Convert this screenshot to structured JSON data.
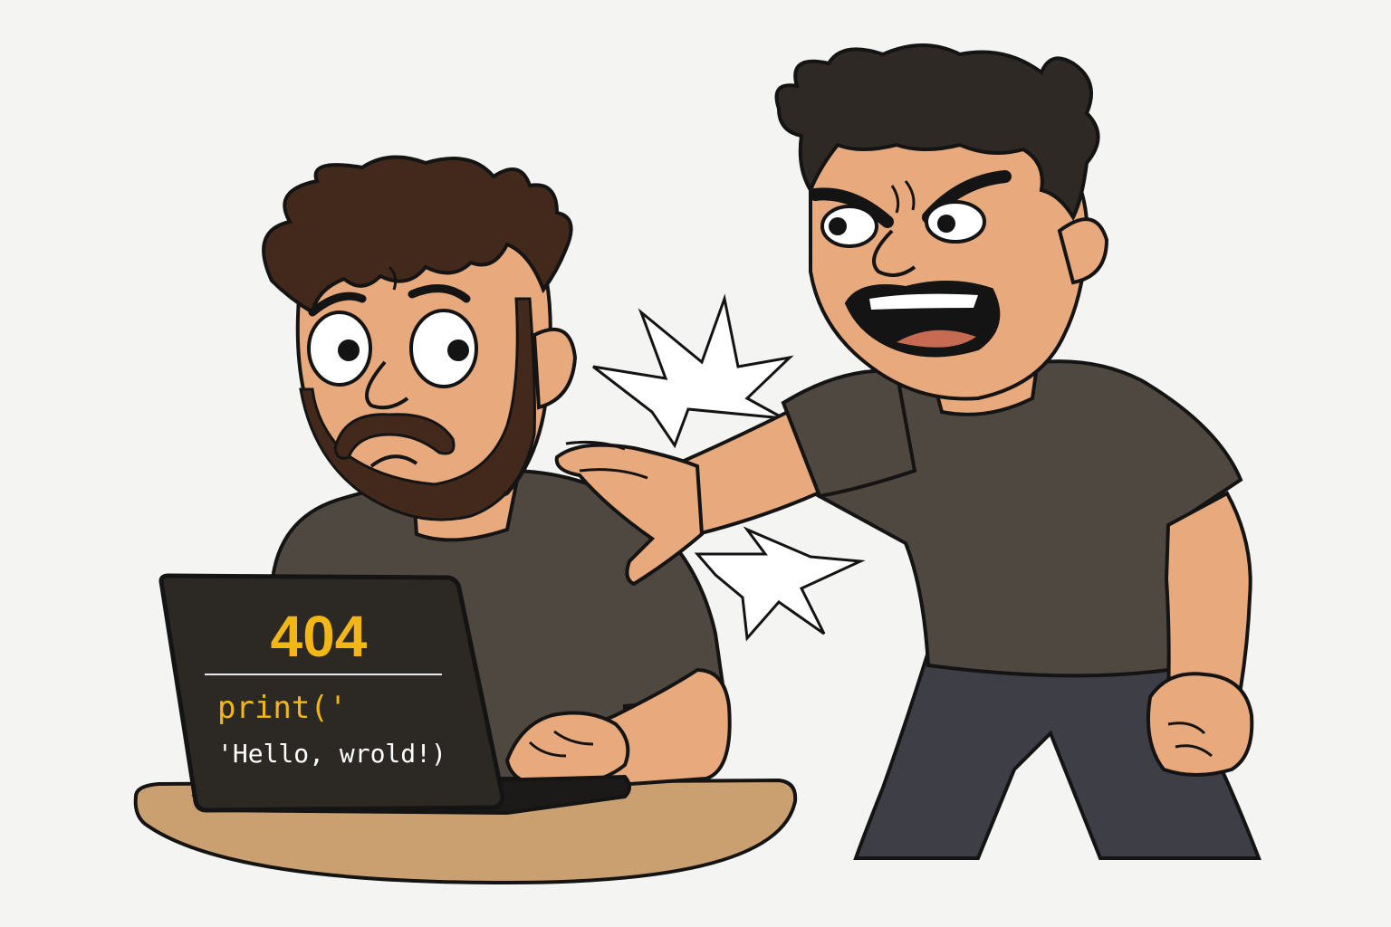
{
  "laptop_screen": {
    "error_code": "404",
    "code_line_1": "print('",
    "code_line_2": "'Hello, wrold!)"
  },
  "colors": {
    "background": "#f4f4f3",
    "skin": "#e8a97c",
    "hair": "#43291c",
    "shirt": "#4f4840",
    "pants": "#3e3f46",
    "desk": "#caa070",
    "laptop": "#2c2925",
    "accent_yellow": "#f2b617",
    "outline": "#141414"
  }
}
